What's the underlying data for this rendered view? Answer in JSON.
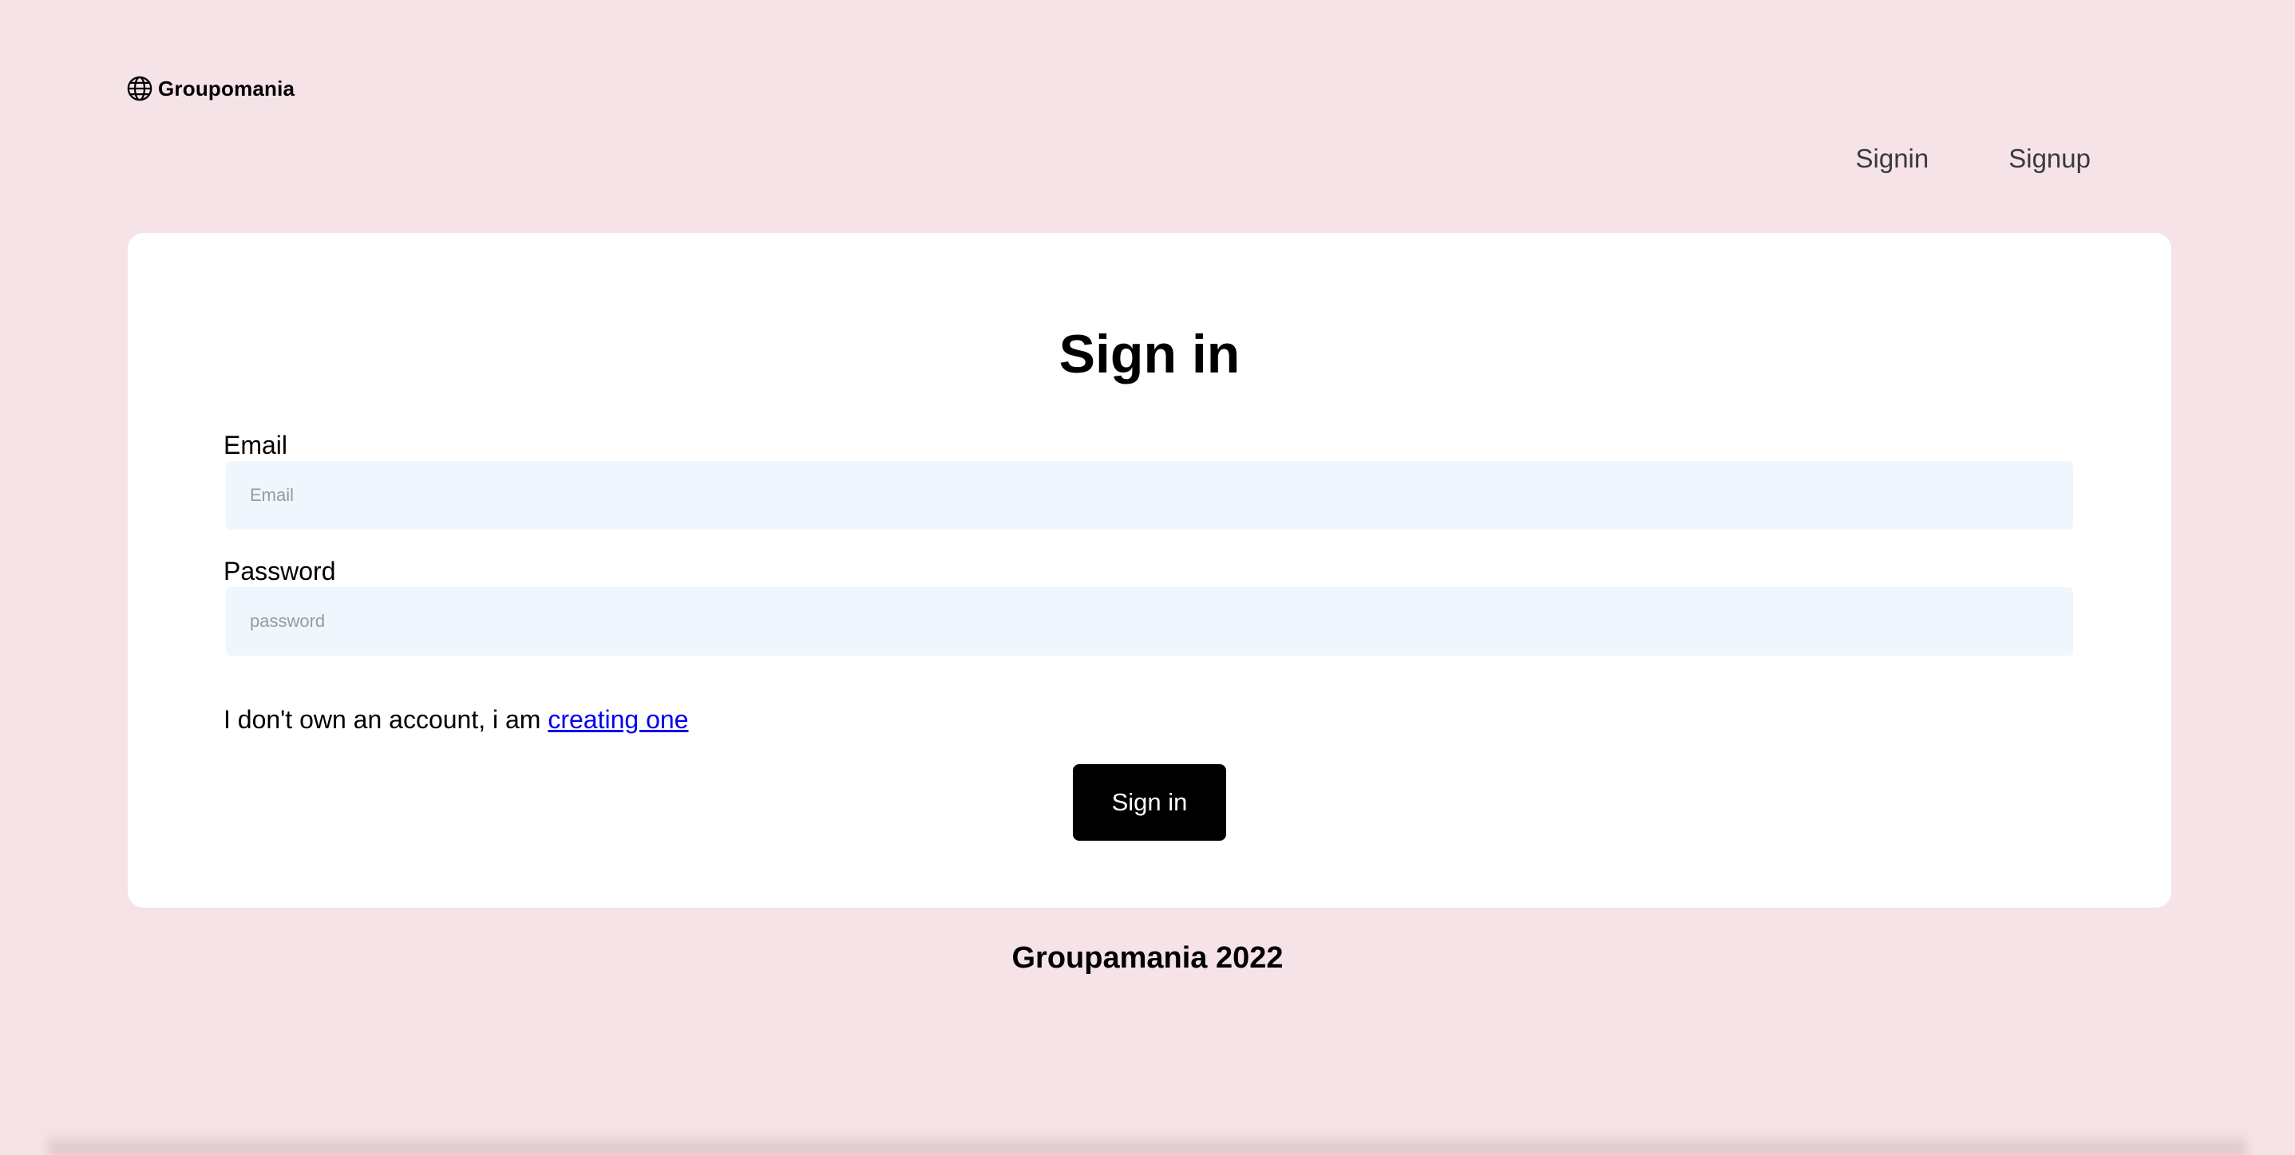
{
  "brand": {
    "name": "Groupomania",
    "icon": "globe-icon"
  },
  "nav": {
    "signin_label": "Signin",
    "signup_label": "Signup"
  },
  "form": {
    "title": "Sign in",
    "email": {
      "label": "Email",
      "placeholder": "Email",
      "value": ""
    },
    "password": {
      "label": "Password",
      "placeholder": "password",
      "value": ""
    },
    "account_prompt": "I don't own an account, i am ",
    "account_link": "creating one",
    "submit_label": "Sign in"
  },
  "footer": {
    "text": "Groupamania 2022"
  },
  "colors": {
    "page_background": "#f6e3e7",
    "card_background": "#ffffff",
    "input_background": "#eff6fd",
    "button_background": "#000000",
    "link": "#0000ee"
  }
}
